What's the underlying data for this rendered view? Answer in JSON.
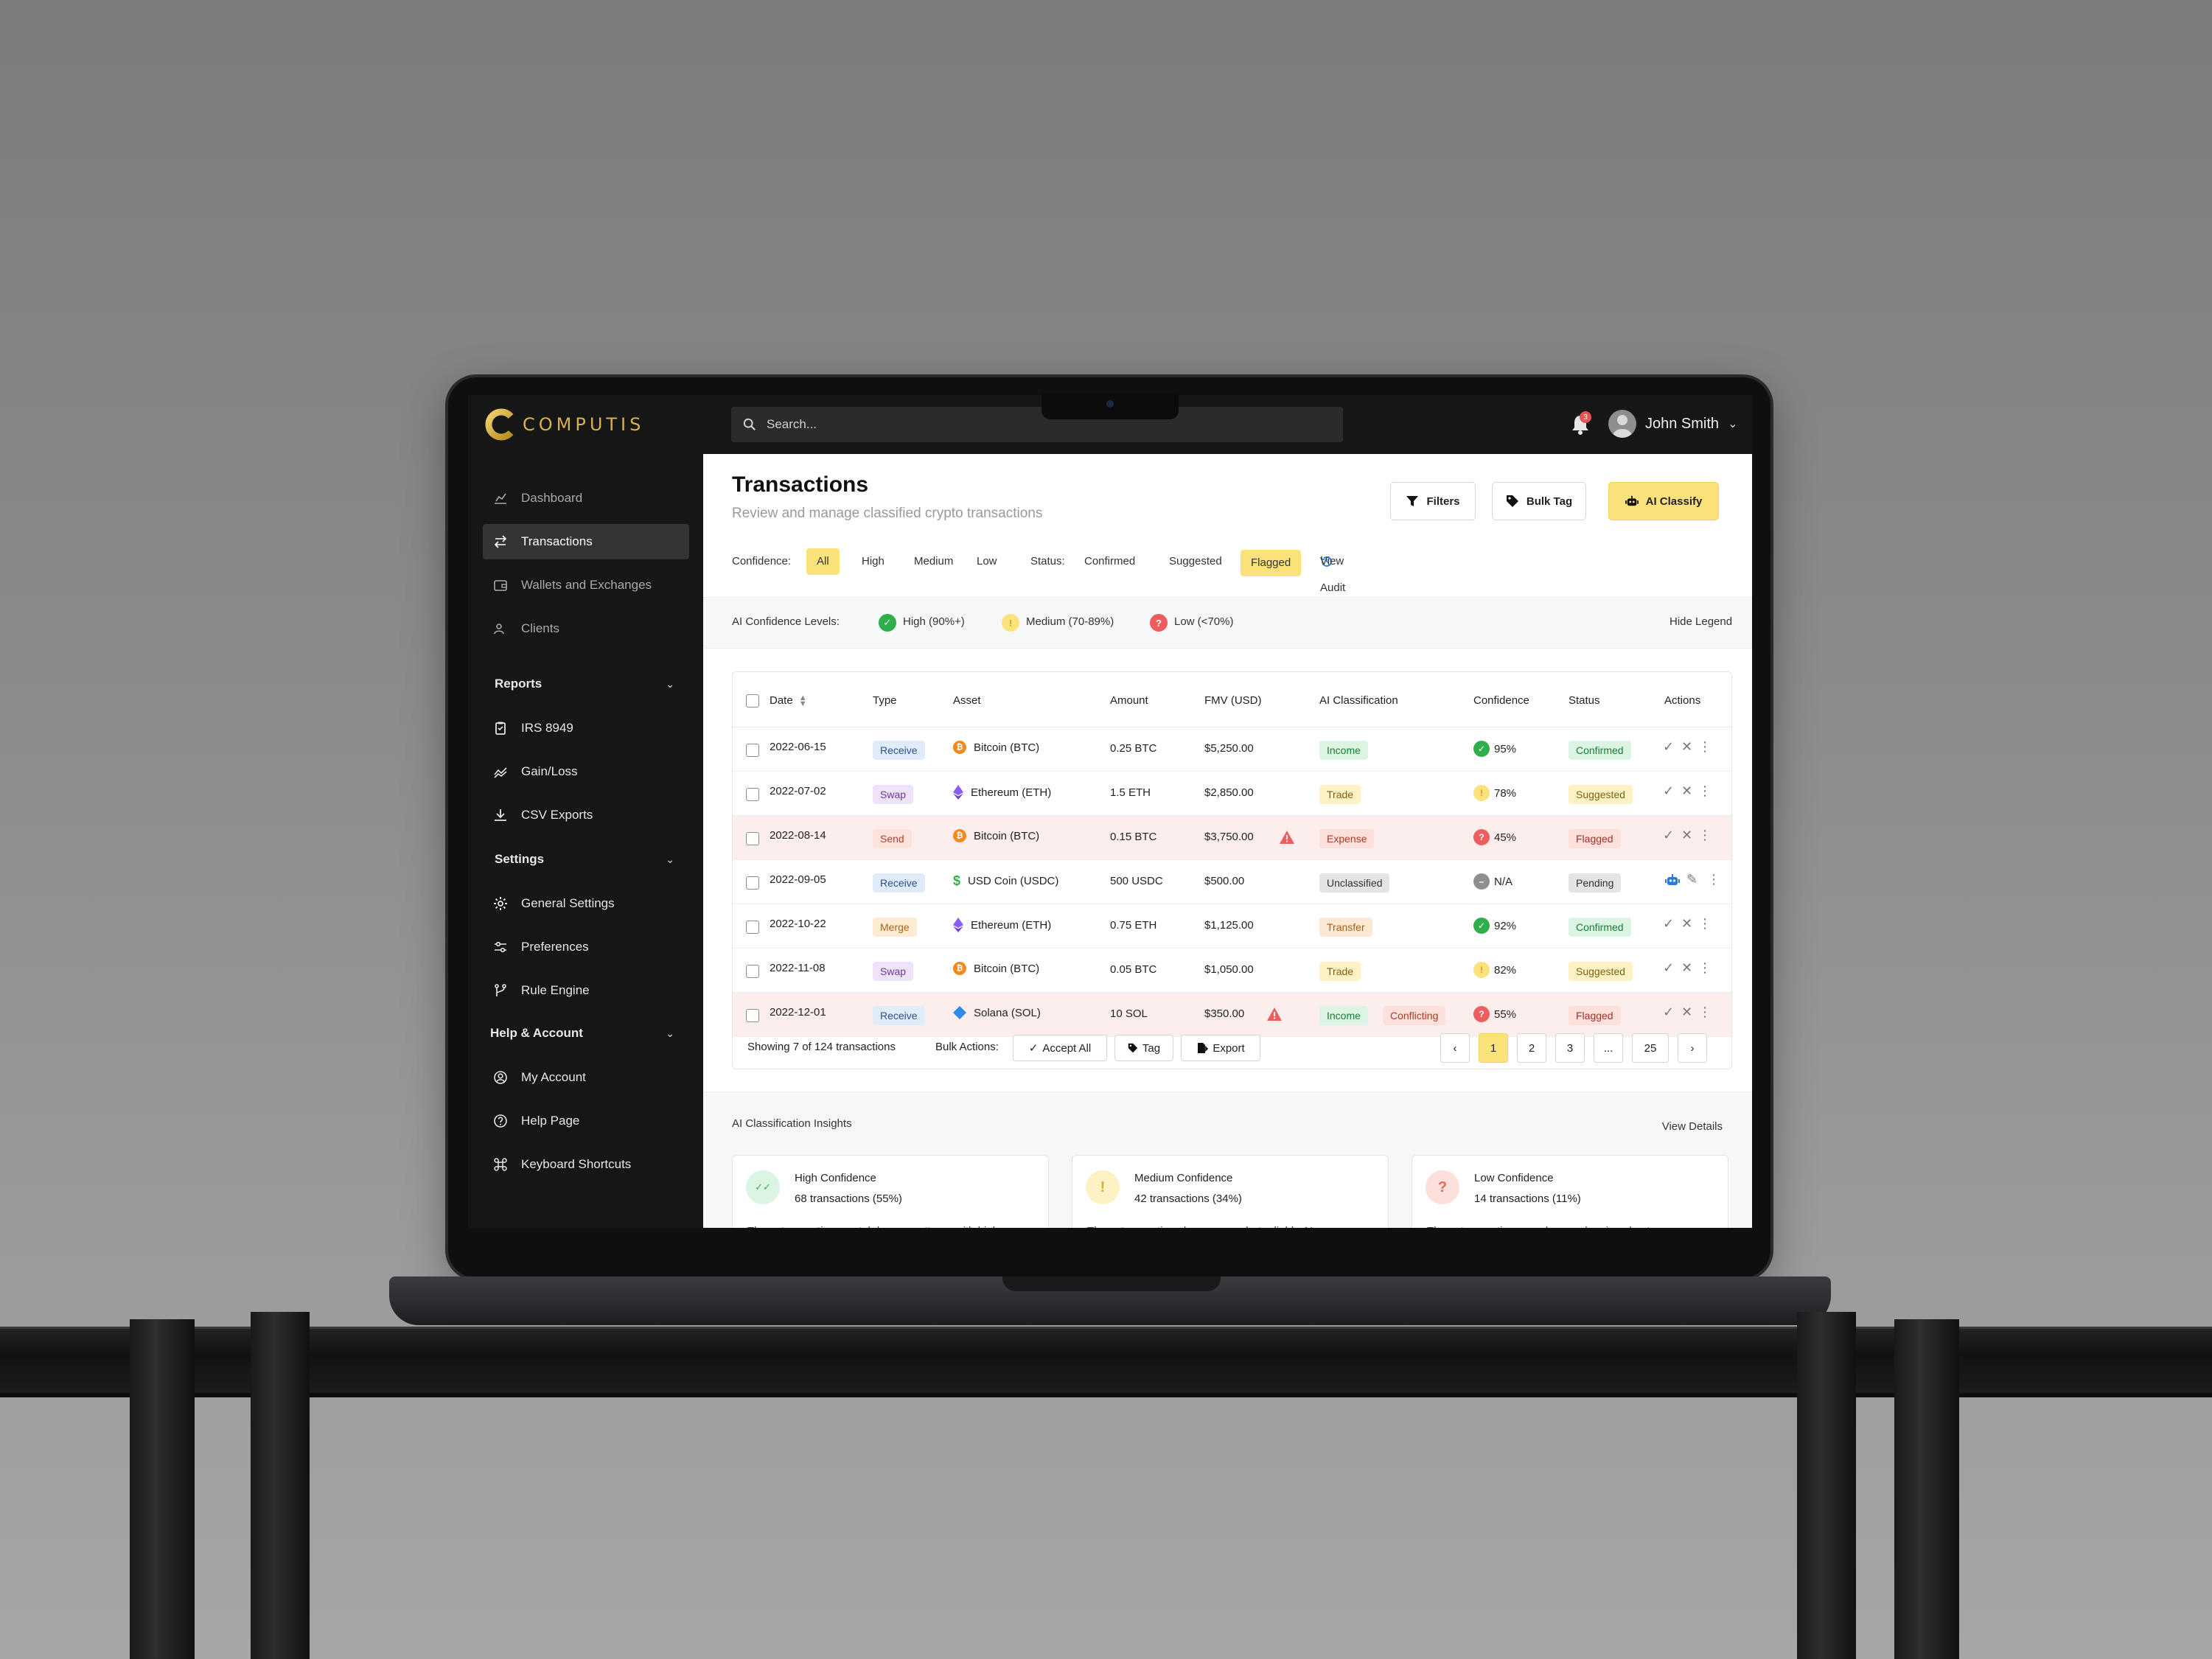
{
  "app": {
    "logo_text": "COMPUTIS",
    "colors": {
      "accent": "#fbe27a",
      "brand_gold": "#d6b24a",
      "sidebar": "#161616"
    }
  },
  "sidebar": {
    "items": [
      {
        "label": "Dashboard",
        "icon": "chart-icon"
      },
      {
        "label": "Transactions",
        "icon": "swap-arrows-icon",
        "active": true
      },
      {
        "label": "Wallets and Exchanges",
        "icon": "wallet-icon"
      },
      {
        "label": "Clients",
        "icon": "users-icon"
      }
    ],
    "reports": {
      "label": "Reports",
      "items": [
        {
          "label": "IRS 8949",
          "icon": "clipboard-icon"
        },
        {
          "label": "Gain/Loss",
          "icon": "trend-icon"
        },
        {
          "label": "CSV Exports",
          "icon": "download-icon"
        }
      ]
    },
    "settings": {
      "label": "Settings",
      "items": [
        {
          "label": "General Settings",
          "icon": "gear-icon"
        },
        {
          "label": "Preferences",
          "icon": "sliders-icon"
        },
        {
          "label": "Rule Engine",
          "icon": "branch-icon"
        }
      ]
    },
    "help": {
      "label": "Help & Account",
      "items": [
        {
          "label": "My Account",
          "icon": "user-circle-icon"
        },
        {
          "label": "Help Page",
          "icon": "question-circle-icon"
        },
        {
          "label": "Keyboard Shortcuts",
          "icon": "command-icon"
        }
      ]
    }
  },
  "topbar": {
    "search_placeholder": "Search...",
    "notification_count": "3",
    "user_name": "John Smith"
  },
  "page": {
    "title": "Transactions",
    "subtitle": "Review and manage classified crypto transactions",
    "buttons": {
      "filters": "Filters",
      "bulk_tag": "Bulk Tag",
      "ai_classify": "AI Classify"
    }
  },
  "filters": {
    "confidence_label": "Confidence:",
    "confidence_options": [
      "All",
      "High",
      "Medium",
      "Low"
    ],
    "confidence_selected": "All",
    "status_label": "Status:",
    "status_options": [
      "Confirmed",
      "Suggested",
      "Flagged"
    ],
    "status_selected": "Flagged",
    "audit_link": "View Audit Trail"
  },
  "legend": {
    "label": "AI Confidence Levels:",
    "high": "High (90%+)",
    "medium": "Medium (70-89%)",
    "low": "Low (<70%)",
    "hide": "Hide Legend"
  },
  "table": {
    "headers": [
      "Date",
      "Type",
      "Asset",
      "Amount",
      "FMV (USD)",
      "AI Classification",
      "Confidence",
      "Status",
      "Actions"
    ],
    "rows": [
      {
        "date": "2022-06-15",
        "type": "Receive",
        "asset": "Bitcoin (BTC)",
        "asset_icon": "btc",
        "amount": "0.25 BTC",
        "fmv": "$5,250.00",
        "classification": [
          "Income"
        ],
        "confidence": "95%",
        "level": "high",
        "status": "Confirmed",
        "warn": false,
        "flagged": false
      },
      {
        "date": "2022-07-02",
        "type": "Swap",
        "asset": "Ethereum (ETH)",
        "asset_icon": "eth",
        "amount": "1.5 ETH",
        "fmv": "$2,850.00",
        "classification": [
          "Trade"
        ],
        "confidence": "78%",
        "level": "medium",
        "status": "Suggested",
        "warn": false,
        "flagged": false
      },
      {
        "date": "2022-08-14",
        "type": "Send",
        "asset": "Bitcoin (BTC)",
        "asset_icon": "btc",
        "amount": "0.15 BTC",
        "fmv": "$3,750.00",
        "classification": [
          "Expense"
        ],
        "confidence": "45%",
        "level": "low",
        "status": "Flagged",
        "warn": true,
        "flagged": true
      },
      {
        "date": "2022-09-05",
        "type": "Receive",
        "asset": "USD Coin (USDC)",
        "asset_icon": "usdc",
        "amount": "500 USDC",
        "fmv": "$500.00",
        "classification": [
          "Unclassified"
        ],
        "confidence": "N/A",
        "level": "none",
        "status": "Pending",
        "warn": false,
        "flagged": false
      },
      {
        "date": "2022-10-22",
        "type": "Merge",
        "asset": "Ethereum (ETH)",
        "asset_icon": "eth",
        "amount": "0.75 ETH",
        "fmv": "$1,125.00",
        "classification": [
          "Transfer"
        ],
        "confidence": "92%",
        "level": "high",
        "status": "Confirmed",
        "warn": false,
        "flagged": false
      },
      {
        "date": "2022-11-08",
        "type": "Swap",
        "asset": "Bitcoin (BTC)",
        "asset_icon": "btc",
        "amount": "0.05 BTC",
        "fmv": "$1,050.00",
        "classification": [
          "Trade"
        ],
        "confidence": "82%",
        "level": "medium",
        "status": "Suggested",
        "warn": false,
        "flagged": false
      },
      {
        "date": "2022-12-01",
        "type": "Receive",
        "asset": "Solana (SOL)",
        "asset_icon": "sol",
        "amount": "10 SOL",
        "fmv": "$350.00",
        "classification": [
          "Income",
          "Conflicting"
        ],
        "confidence": "55%",
        "level": "low",
        "status": "Flagged",
        "warn": true,
        "flagged": true
      }
    ],
    "footer": {
      "showing": "Showing 7 of 124 transactions",
      "bulk_label": "Bulk Actions:",
      "accept_all": "Accept All",
      "tag": "Tag",
      "export": "Export",
      "pages": [
        "1",
        "2",
        "3",
        "...",
        "25"
      ],
      "current_page": "1"
    }
  },
  "insights": {
    "title": "AI Classification Insights",
    "view_details": "View Details",
    "cards": [
      {
        "name": "High Confidence",
        "count": "68 transactions (55%)",
        "desc": "These transactions match known patterns with high",
        "level": "high"
      },
      {
        "name": "Medium Confidence",
        "count": "42 transactions (34%)",
        "desc": "These transactions have somewhat reliable AI",
        "level": "medium"
      },
      {
        "name": "Low Confidence",
        "count": "14 transactions (11%)",
        "desc": "These transactions need manual review due to",
        "level": "low"
      }
    ]
  }
}
